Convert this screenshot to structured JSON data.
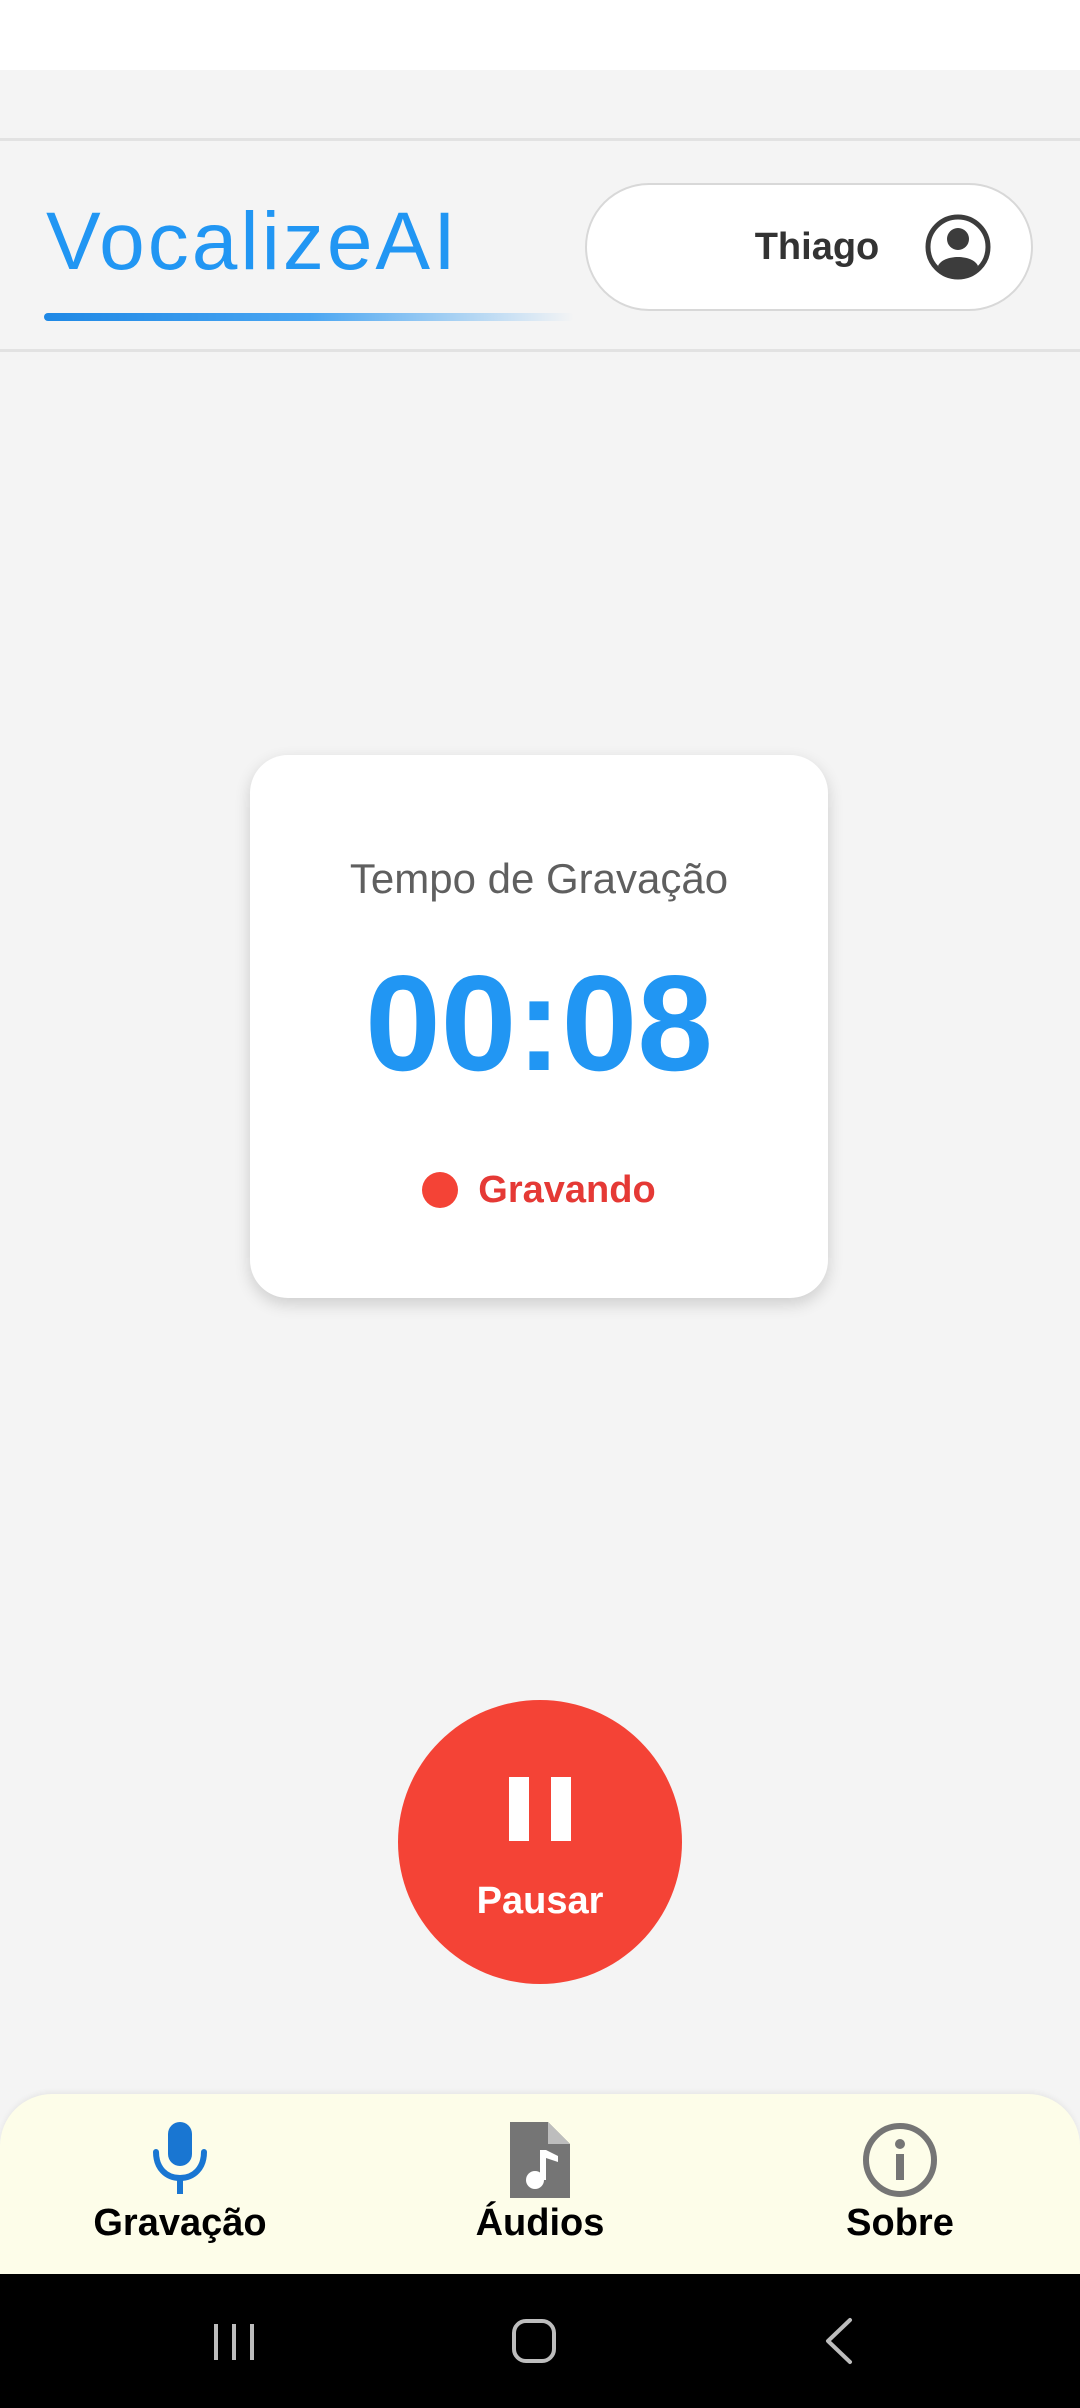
{
  "app": {
    "brand": "VocalizeAI",
    "brand_color": "#2196f3",
    "accent_color": "#f44336"
  },
  "header": {
    "user_name": "Thiago",
    "user_icon": "user-circle-icon"
  },
  "timer": {
    "label": "Tempo de Gravação",
    "value": "00:08",
    "status": "Gravando",
    "status_icon": "recording-dot-icon"
  },
  "controls": {
    "pause_label": "Pausar",
    "pause_icon": "pause-icon"
  },
  "bottom_nav": {
    "items": [
      {
        "label": "Gravação",
        "icon": "microphone-icon",
        "active": true
      },
      {
        "label": "Áudios",
        "icon": "audio-file-icon",
        "active": false
      },
      {
        "label": "Sobre",
        "icon": "info-icon",
        "active": false
      }
    ]
  },
  "system_nav": {
    "items": [
      "recent-apps-icon",
      "home-icon",
      "back-icon"
    ]
  }
}
